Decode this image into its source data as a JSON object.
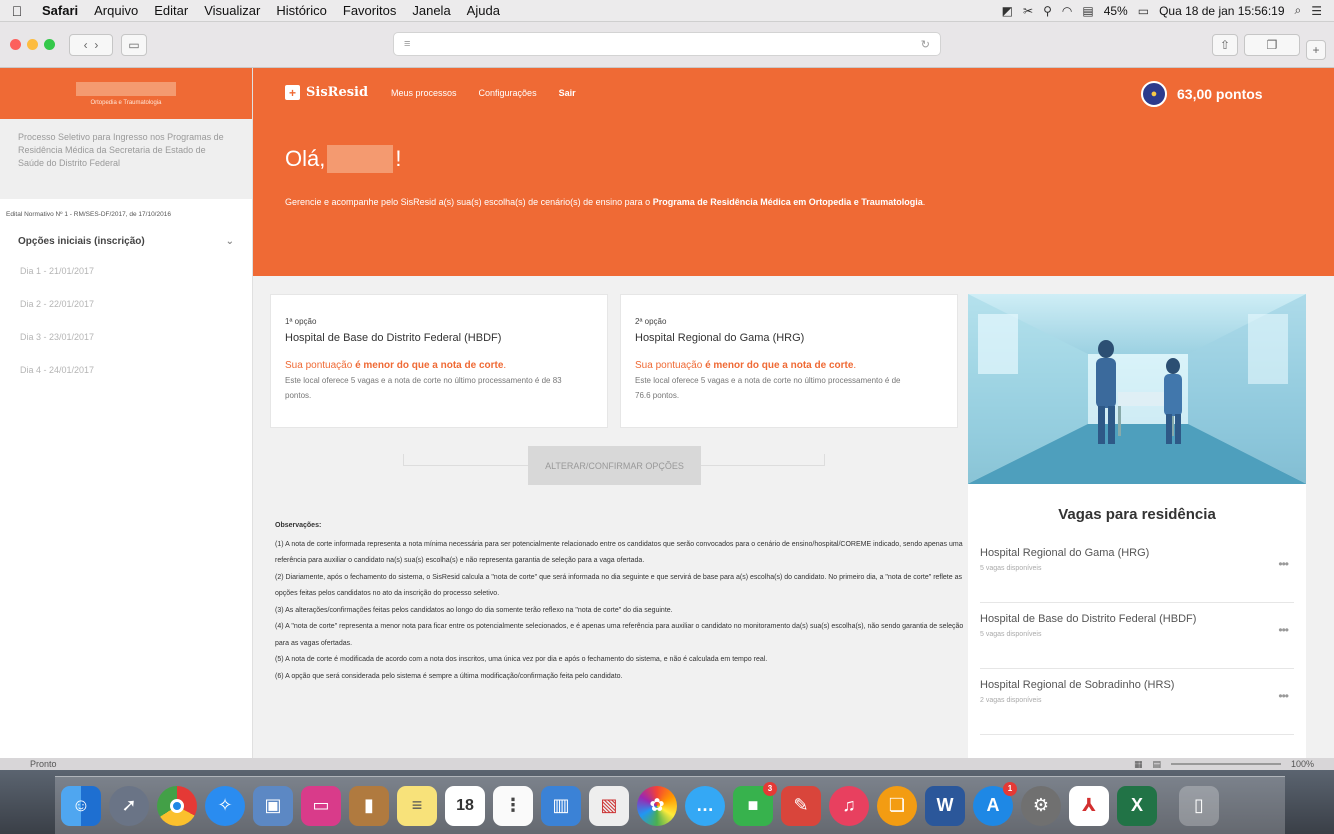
{
  "menubar": {
    "app": "Safari",
    "items": [
      "Arquivo",
      "Editar",
      "Visualizar",
      "Histórico",
      "Favoritos",
      "Janela",
      "Ajuda"
    ],
    "battery": "45%",
    "clock": "Qua 18 de jan  15:56:19"
  },
  "sidebar": {
    "subtitle": "Ortopedia e Traumatologia",
    "description": "Processo Seletivo para Ingresso nos Programas de Residência Médica da Secretaria de Estado de Saúde do Distrito Federal",
    "edital": "Edital Normativo Nº 1 - RM/SES-DF/2017, de 17/10/2016",
    "section_label": "Opções iniciais (inscrição)",
    "days": [
      "Dia 1 - 21/01/2017",
      "Dia 2 - 22/01/2017",
      "Dia 3 - 23/01/2017",
      "Dia 4 - 24/01/2017"
    ]
  },
  "header": {
    "brand": "SisResid",
    "nav": [
      "Meus processos",
      "Configurações",
      "Sair"
    ],
    "points": "63,00 pontos",
    "greeting_prefix": "Olá,",
    "greeting_suffix": "!",
    "intro": "Gerencie e acompanhe pelo SisResid a(s) sua(s) escolha(s) de cenário(s) de ensino para o ",
    "intro_bold": "Programa de Residência Médica em Ortopedia e Traumatologia",
    "intro_end": "."
  },
  "options": [
    {
      "label": "1ª opção",
      "hospital": "Hospital de Base do Distrito Federal (HBDF)",
      "status_prefix": "Sua pontuação ",
      "status_bold": "é menor do que a nota de corte",
      "status_end": ".",
      "info": "Este local oferece 5 vagas e a nota de corte no último processamento é de 83 pontos."
    },
    {
      "label": "2ª opção",
      "hospital": "Hospital Regional do Gama (HRG)",
      "status_prefix": "Sua pontuação ",
      "status_bold": "é menor do que a nota de corte",
      "status_end": ".",
      "info": "Este local oferece 5 vagas e a nota de corte no último processamento é de 76.6 pontos."
    }
  ],
  "confirm_button": "ALTERAR/CONFIRMAR OPÇÕES",
  "observations": {
    "title": "Observações:",
    "items": [
      "(1) A nota de corte informada representa a nota mínima necessária para ser potencialmente relacionado entre os candidatos que serão convocados para o cenário de ensino/hospital/COREME indicado, sendo apenas uma referência para auxiliar o candidato na(s) sua(s) escolha(s) e não representa garantia de seleção para a vaga ofertada.",
      "(2) Diariamente, após o fechamento do sistema, o SisResid calcula a \"nota de corte\" que será informada no dia seguinte e que servirá de base para a(s) escolha(s) do candidato. No primeiro dia, a \"nota de corte\" reflete as opções feitas pelos candidatos no ato da inscrição do processo seletivo.",
      "(3) As alterações/confirmações feitas pelos candidatos ao longo do dia somente terão reflexo na \"nota de corte\" do dia seguinte.",
      "(4) A \"nota de corte\" representa a menor nota para ficar entre os potencialmente selecionados, e é apenas uma referência para auxiliar o candidato no monitoramento da(s) sua(s) escolha(s), não sendo garantia de seleção para as vagas ofertadas.",
      "(5) A nota de corte é modificada de acordo com a nota dos inscritos, uma única vez por dia e após o fechamento do sistema, e não é calculada em tempo real.",
      "(6) A opção que será considerada pelo sistema é sempre a última modificação/confirmação feita pelo candidato."
    ]
  },
  "vagas": {
    "title": "Vagas para residência",
    "items": [
      {
        "name": "Hospital Regional do Gama (HRG)",
        "count": "5 vagas disponíveis"
      },
      {
        "name": "Hospital de Base do Distrito Federal (HBDF)",
        "count": "5 vagas disponíveis"
      },
      {
        "name": "Hospital Regional de Sobradinho (HRS)",
        "count": "2 vagas disponíveis"
      }
    ]
  },
  "statusbar": {
    "text": "Pronto",
    "zoom": "100%"
  },
  "dock": {
    "calendar_day": "18",
    "badges": {
      "facetime": "3",
      "appstore": "1"
    }
  },
  "colors": {
    "accent": "#ef6a35",
    "accent_light": "#f49a70"
  }
}
